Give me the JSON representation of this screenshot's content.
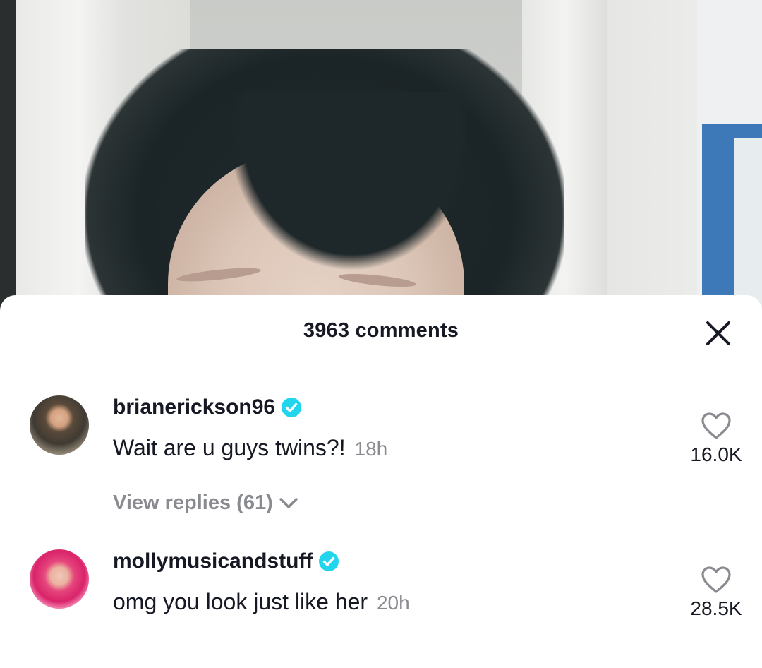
{
  "comments_panel": {
    "title": "3963 comments",
    "close_icon": "close-icon"
  },
  "comments": [
    {
      "username": "brianerickson96",
      "verified": true,
      "text": "Wait are u guys twins?!",
      "time": "18h",
      "like_count": "16.0K",
      "view_replies": "View replies (61)"
    },
    {
      "username": "mollymusicandstuff",
      "verified": true,
      "text": "omg you look just like her",
      "time": "20h",
      "like_count": "28.5K"
    }
  ],
  "colors": {
    "text_primary": "#161823",
    "text_secondary": "#8a8b91",
    "verified_badge": "#20d5ec"
  }
}
